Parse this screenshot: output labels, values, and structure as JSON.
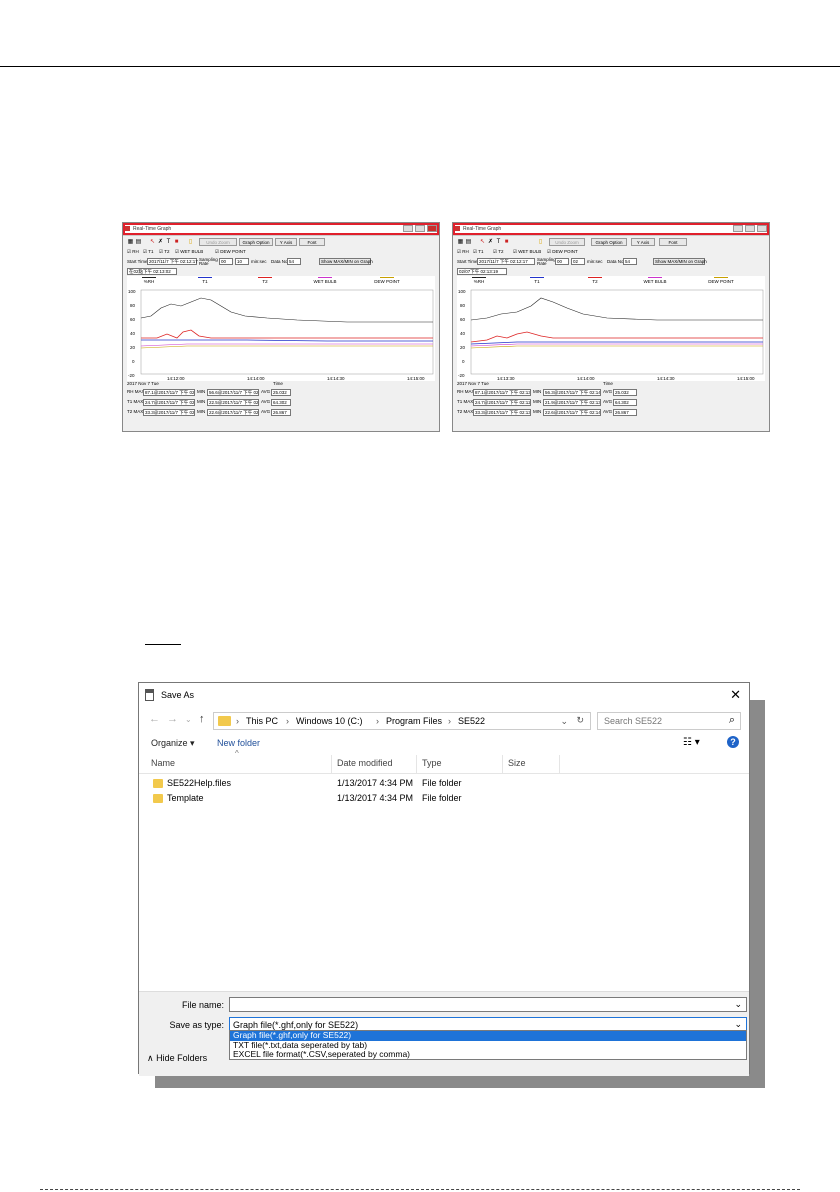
{
  "rtg_left": {
    "title": "Real-Time Graph",
    "zoom_btn": "Undo Zoom",
    "graph_option_btn": "Graph Option",
    "yaxis_btn": "Y Axis",
    "font_btn": "Font",
    "check_rh": "RH",
    "check_t1": "T1",
    "check_t2": "T2",
    "check_wet": "WET BULB",
    "check_dew": "DEW POINT",
    "start_label": "Start Time",
    "start_value": "2017/11/7 下午 02:12:17",
    "rate_label": "Sampling Rate",
    "rate_h": "00",
    "rate_m": "10",
    "rate_unit": "min:sec",
    "datano_label": "Data No.",
    "datano_value": "54",
    "showmax_btn": "Show MAX/MIN on Graph",
    "cursor_value": "在02點下午 02:13:02",
    "legend": [
      "%RH",
      "T1",
      "T2",
      "WET BULB",
      "DEW POINT"
    ],
    "yticks": [
      "100",
      "80",
      "60",
      "40",
      "20",
      "0",
      "-20"
    ],
    "xticks": [
      "14:12:00",
      "14:14:00",
      "14:14:30",
      "14:15:00"
    ],
    "date": "2017 Nov 7 Tue",
    "time": "Time",
    "stats": [
      {
        "lbl": "RH MAX",
        "max": "87.1@2017/11/7 下午 02:13:4",
        "min": "56.6@2017/11/7 下午 02:13:3",
        "avg": "25.032"
      },
      {
        "lbl": "T1 MAX",
        "max": "24.7@2017/11/7 下午 02:12:4",
        "min": "22.5@2017/11/7 下午 02:13:1",
        "avg": "64.302"
      },
      {
        "lbl": "T2 MAX",
        "max": "33.3@2017/11/7 下午 02:13:3",
        "min": "22.6@2017/11/7 下午 02:13:5",
        "avg": "26.867"
      }
    ]
  },
  "rtg_right": {
    "title": "Real-Time Graph",
    "zoom_btn": "Undo Zoom",
    "graph_option_btn": "Graph Option",
    "yaxis_btn": "Y Axis",
    "font_btn": "Font",
    "check_rh": "RH",
    "check_t1": "T1",
    "check_t2": "T2",
    "check_wet": "WET BULB",
    "check_dew": "DEW POINT",
    "start_label": "Start Time",
    "start_value": "2017/11/7 下午 02:12:17",
    "rate_label": "Sampling Rate",
    "rate_h": "00",
    "rate_m": "02",
    "rate_unit": "min:sec",
    "datano_label": "Data No.",
    "datano_value": "54",
    "showmax_btn": "Show MAX/MIN on Graph",
    "cursor_value": "02/07下午 02:13:19",
    "legend": [
      "%RH",
      "T1",
      "T2",
      "WET BULB",
      "DEW POINT"
    ],
    "yticks": [
      "100",
      "80",
      "60",
      "40",
      "20",
      "0",
      "-20"
    ],
    "xticks": [
      "14:13:30",
      "14:14:00",
      "14:14:30",
      "14:15:00"
    ],
    "date": "2017 Nov 7 Tue",
    "time": "Time",
    "stats": [
      {
        "lbl": "RH MAX",
        "max": "87.1@2017/11/7 下午 02:13:4",
        "min": "56.3@2017/11/7 下午 02:14:5",
        "avg": "25.032"
      },
      {
        "lbl": "T1 MAX",
        "max": "24.7@2017/11/7 下午 02:12:4",
        "min": "21.9@2017/11/7 下午 02:13:1",
        "avg": "64.302"
      },
      {
        "lbl": "T2 MAX",
        "max": "33.3@2017/11/7 下午 02:13:3",
        "min": "22.6@2017/11/7 下午 02:14:5",
        "avg": "26.867"
      }
    ]
  },
  "dialog": {
    "title": "Save As",
    "crumbs": [
      "This PC",
      "Windows 10 (C:)",
      "Program Files",
      "SE522"
    ],
    "search_placeholder": "Search SE522",
    "organize": "Organize ▾",
    "new_folder": "New folder",
    "columns": [
      "Name",
      "Date modified",
      "Type",
      "Size"
    ],
    "files": [
      {
        "name": "SE522Help.files",
        "date": "1/13/2017 4:34 PM",
        "type": "File folder"
      },
      {
        "name": "Template",
        "date": "1/13/2017 4:34 PM",
        "type": "File folder"
      }
    ],
    "file_name_label": "File name:",
    "file_name_value": "",
    "save_type_label": "Save as type:",
    "save_type_value": "Graph file(*.ghf,only for SE522)",
    "options": [
      "Graph file(*.ghf,only for SE522)",
      "TXT file(*.txt,data seperated by tab)",
      "EXCEL file format(*.CSV,seperated by comma)"
    ],
    "hide_folders": "Hide Folders"
  }
}
